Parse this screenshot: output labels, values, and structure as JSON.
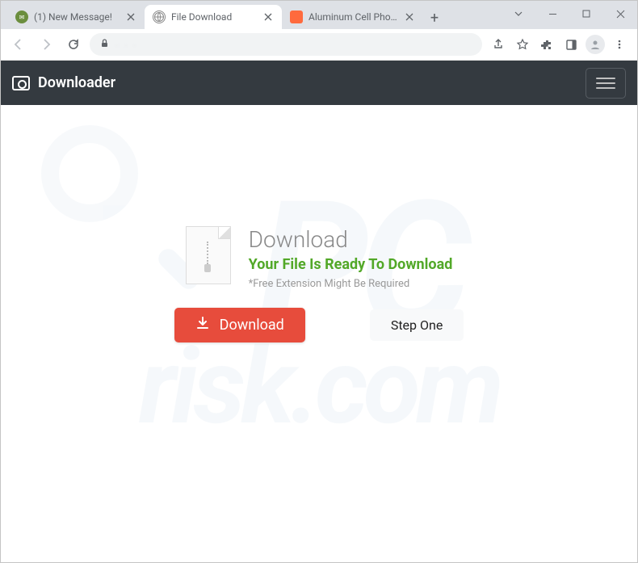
{
  "window": {
    "tabs": [
      {
        "title": "(1) New Message!",
        "favicon_bg": "#6b8e3e"
      },
      {
        "title": "File Download",
        "favicon_bg": "#ffffff",
        "active": true
      },
      {
        "title": "Aluminum Cell Phone H",
        "favicon_bg": "#ff6a3d"
      }
    ]
  },
  "omnibox": {
    "url_obscured": ". . ."
  },
  "header": {
    "brand": "Downloader"
  },
  "content": {
    "heading": "Download",
    "ready_text": "Your File Is Ready To Download",
    "note": "*Free Extension Might Be Required",
    "download_button": "Download",
    "step_button": "Step One"
  },
  "watermark": {
    "line1": "PC",
    "line2": "risk.com"
  }
}
